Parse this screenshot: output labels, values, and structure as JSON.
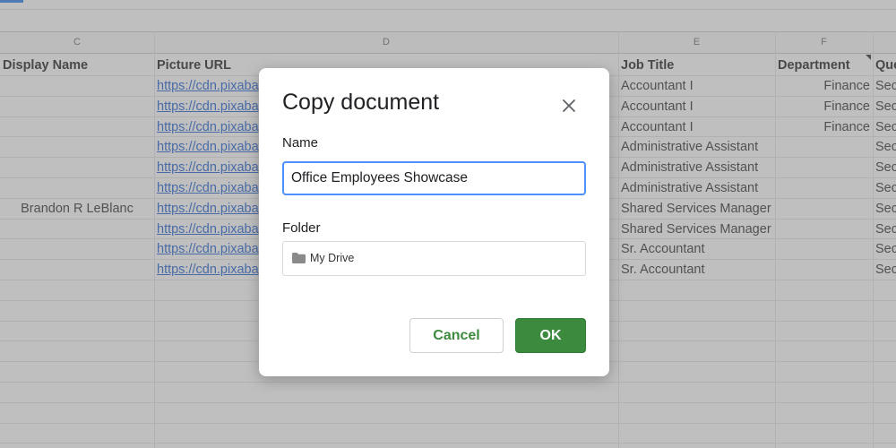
{
  "sheet": {
    "column_letters": [
      "C",
      "D",
      "E",
      "F"
    ],
    "header_row": {
      "display_name": "Display Name",
      "picture_url": "Picture URL",
      "job_title": "Job Title",
      "department": "Department",
      "next_col": "Que"
    },
    "rows": [
      {
        "display_name": "",
        "picture_url": "https://cdn.pixabay",
        "job_title": "Accountant I",
        "department": "Finance",
        "next_col": "Sec"
      },
      {
        "display_name": "",
        "picture_url": "https://cdn.pixabay",
        "job_title": "Accountant I",
        "department": "Finance",
        "next_col": "Sec"
      },
      {
        "display_name": "",
        "picture_url": "https://cdn.pixabay",
        "job_title": "Accountant I",
        "department": "Finance",
        "next_col": "Sec"
      },
      {
        "display_name": "",
        "picture_url": "https://cdn.pixabay",
        "job_title": "Administrative Assistant",
        "department": "",
        "next_col": "Sec"
      },
      {
        "display_name": "",
        "picture_url": "https://cdn.pixabay",
        "job_title": "Administrative Assistant",
        "department": "",
        "next_col": "Sec"
      },
      {
        "display_name": "",
        "picture_url": "https://cdn.pixabay",
        "job_title": "Administrative Assistant",
        "department": "",
        "next_col": "Sec"
      },
      {
        "display_name": "Brandon R LeBlanc",
        "picture_url": "https://cdn.pixabay",
        "job_title": "Shared Services Manager",
        "department": "",
        "next_col": "Sec"
      },
      {
        "display_name": "",
        "picture_url": "https://cdn.pixabay",
        "job_title": "Shared Services Manager",
        "department": "",
        "next_col": "Sec"
      },
      {
        "display_name": "",
        "picture_url": "https://cdn.pixabay",
        "job_title": "Sr. Accountant",
        "department": "",
        "next_col": "Sec"
      },
      {
        "display_name": "",
        "picture_url": "https://cdn.pixabay",
        "job_title": "Sr. Accountant",
        "department": "",
        "next_col": "Sec"
      }
    ]
  },
  "dialog": {
    "title": "Copy document",
    "close_icon": "close-icon",
    "name_label": "Name",
    "name_value": "Office Employees Showcase",
    "folder_label": "Folder",
    "folder_icon": "folder-icon",
    "folder_value": "My Drive",
    "cancel_label": "Cancel",
    "ok_label": "OK"
  },
  "colors": {
    "accent_green": "#3b8a3e",
    "input_focus_blue": "#4d90fe",
    "link_blue": "#1155cc"
  }
}
